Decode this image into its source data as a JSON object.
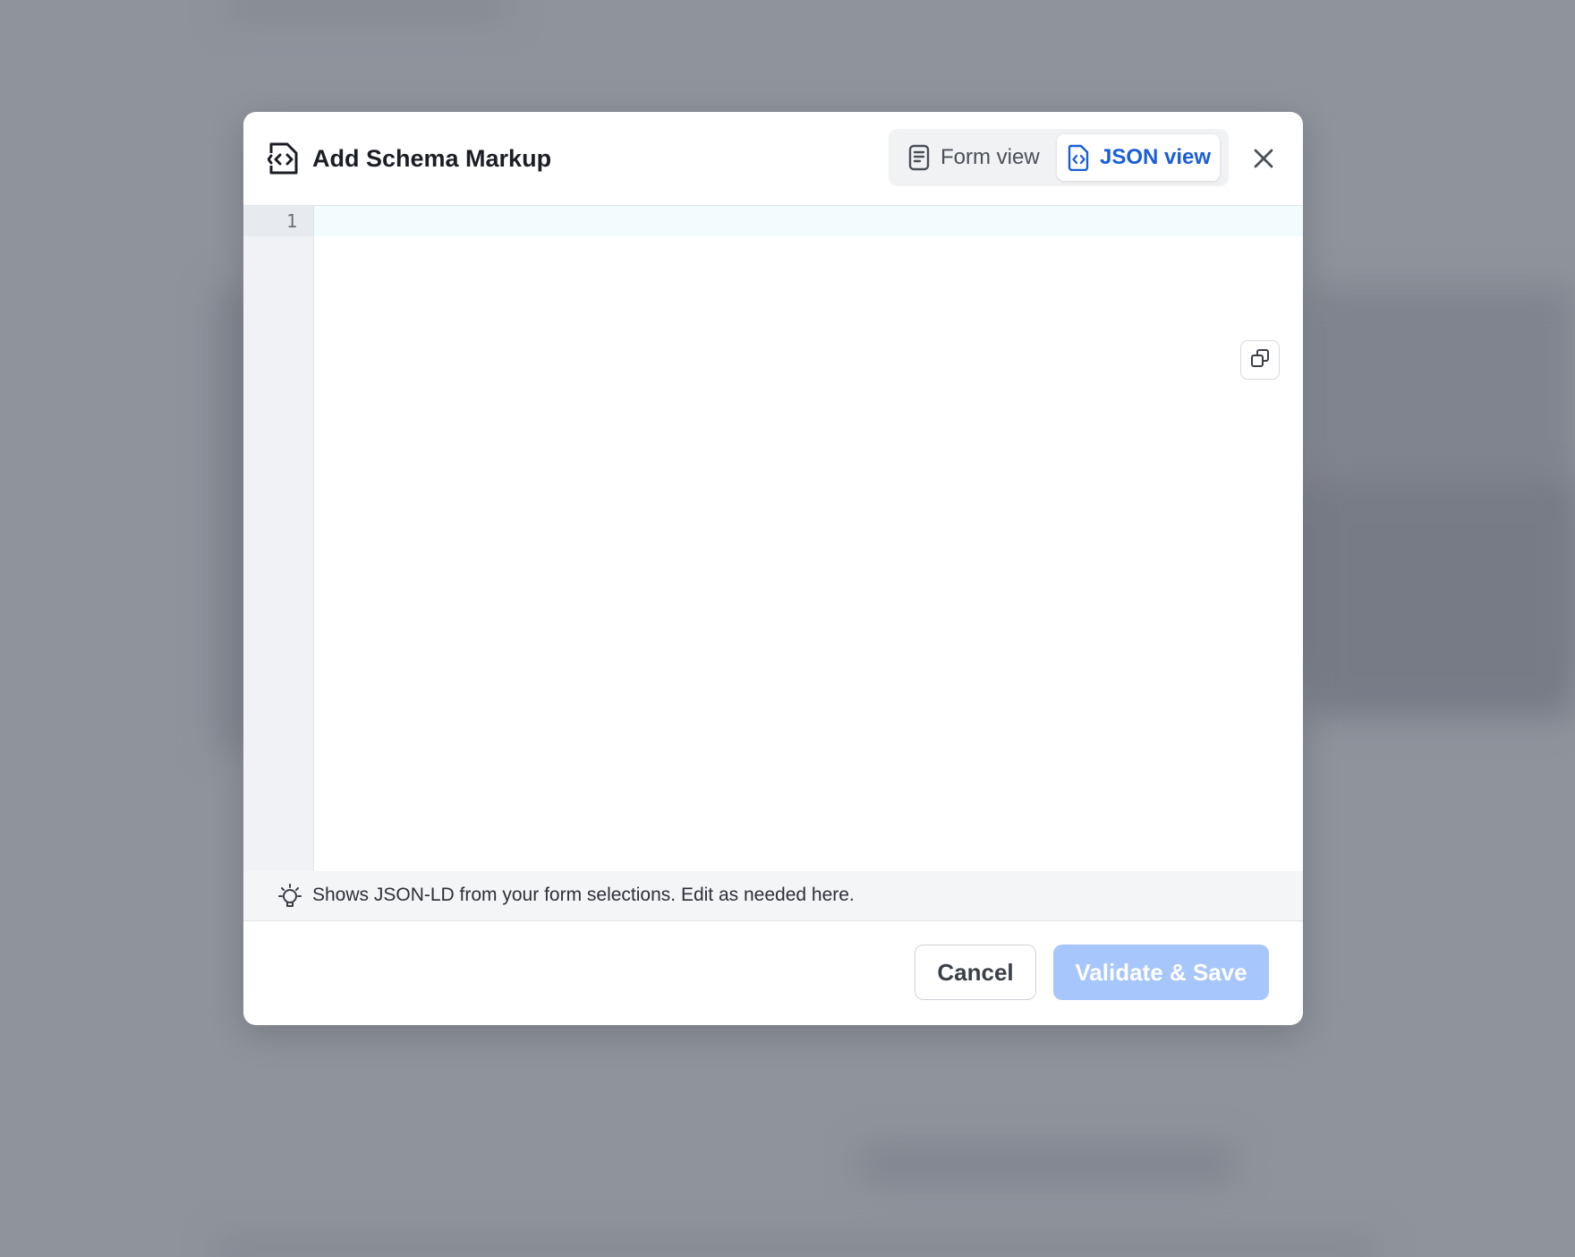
{
  "dialog": {
    "title": "Add Schema Markup",
    "icon": "file-code-icon"
  },
  "view_toggle": {
    "form_view_label": "Form view",
    "json_view_label": "JSON view",
    "active": "JSON view"
  },
  "editor": {
    "line_numbers": [
      "1"
    ],
    "content": "",
    "copy_icon": "copy-icon"
  },
  "hint": {
    "text": "Shows JSON-LD from your form selections. Edit as needed here.",
    "icon": "lightbulb-icon"
  },
  "footer": {
    "cancel_label": "Cancel",
    "save_label": "Validate & Save"
  },
  "colors": {
    "accent": "#1a5fd6",
    "save_disabled": "#a7c6fb",
    "backdrop": "#8f939c"
  }
}
